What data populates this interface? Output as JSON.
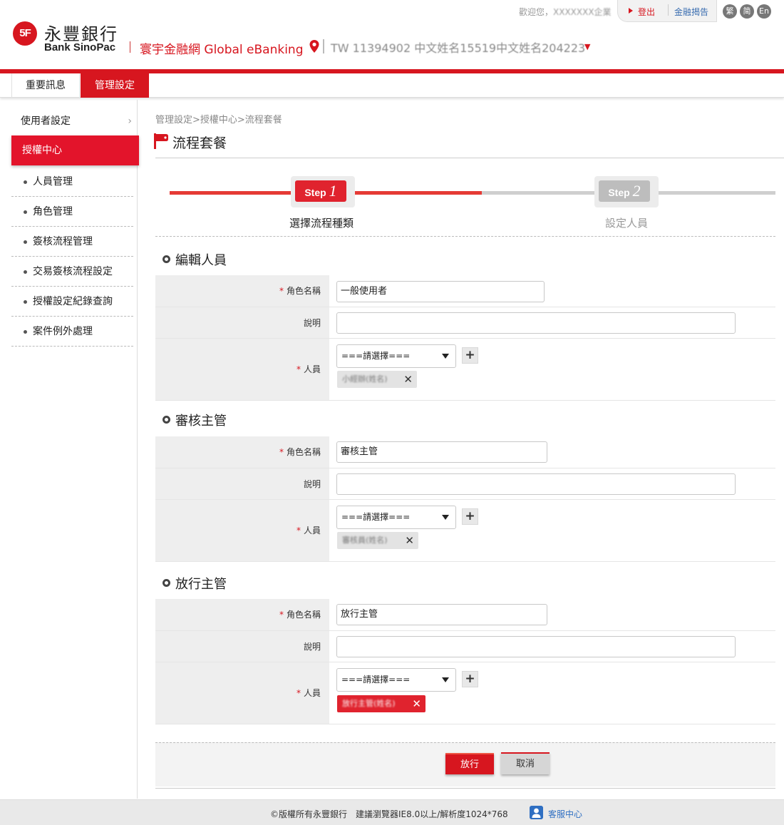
{
  "header": {
    "logo_mark": "5F",
    "bank_name_cn": "永豐銀行",
    "bank_name_en": "Bank SinoPac",
    "service_name": "寰宇金融網 Global eBanking",
    "account_selector": "TW 11394902 中文姓名15519中文姓名204223",
    "welcome_prefix": "歡迎您，",
    "welcome_user": "XXXXXXX企業",
    "logout": "登出",
    "announcement": "金融揭告",
    "languages": [
      "繁",
      "简",
      "En"
    ]
  },
  "menubar": {
    "tabs": [
      {
        "label": "重要訊息",
        "active": false
      },
      {
        "label": "管理設定",
        "active": true
      }
    ]
  },
  "sidebar": {
    "user_settings": "使用者設定",
    "auth_center": "授權中心",
    "items": [
      "人員管理",
      "角色管理",
      "簽核流程管理",
      "交易簽核流程設定",
      "授權設定紀錄查詢",
      "案件例外處理"
    ]
  },
  "breadcrumb": "管理設定>授權中心>流程套餐",
  "page_title": "流程套餐",
  "steps": [
    {
      "word": "Step",
      "num": "1",
      "label": "選擇流程種類",
      "active": true
    },
    {
      "word": "Step",
      "num": "2",
      "label": "設定人員",
      "active": false
    }
  ],
  "labels": {
    "role_name": "角色名稱",
    "description": "說明",
    "people": "人員",
    "required_mark": "*"
  },
  "sections": [
    {
      "title": "編輯人員",
      "role_name_value": "一般使用者",
      "description_value": "",
      "select_value": "===請選擇===",
      "tag": "小經辦(姓名)"
    },
    {
      "title": "審核主管",
      "role_name_value": "審核主管",
      "description_value": "",
      "select_value": "===請選擇===",
      "tag": "審核員(姓名)"
    },
    {
      "title": "放行主管",
      "role_name_value": "放行主管",
      "description_value": "",
      "select_value": "===請選擇===",
      "tag": "放行主管(姓名)"
    }
  ],
  "buttons": {
    "release": "放行",
    "cancel": "取消"
  },
  "footer": {
    "copyright": "©版權所有永豐銀行　建議瀏覽器IE8.0以上/解析度1024*768",
    "customer_service": "客服中心"
  },
  "colors": {
    "brand_red": "#d7161f",
    "link_blue": "#2f6fc2",
    "inactive_gray": "#bdbdbd"
  }
}
